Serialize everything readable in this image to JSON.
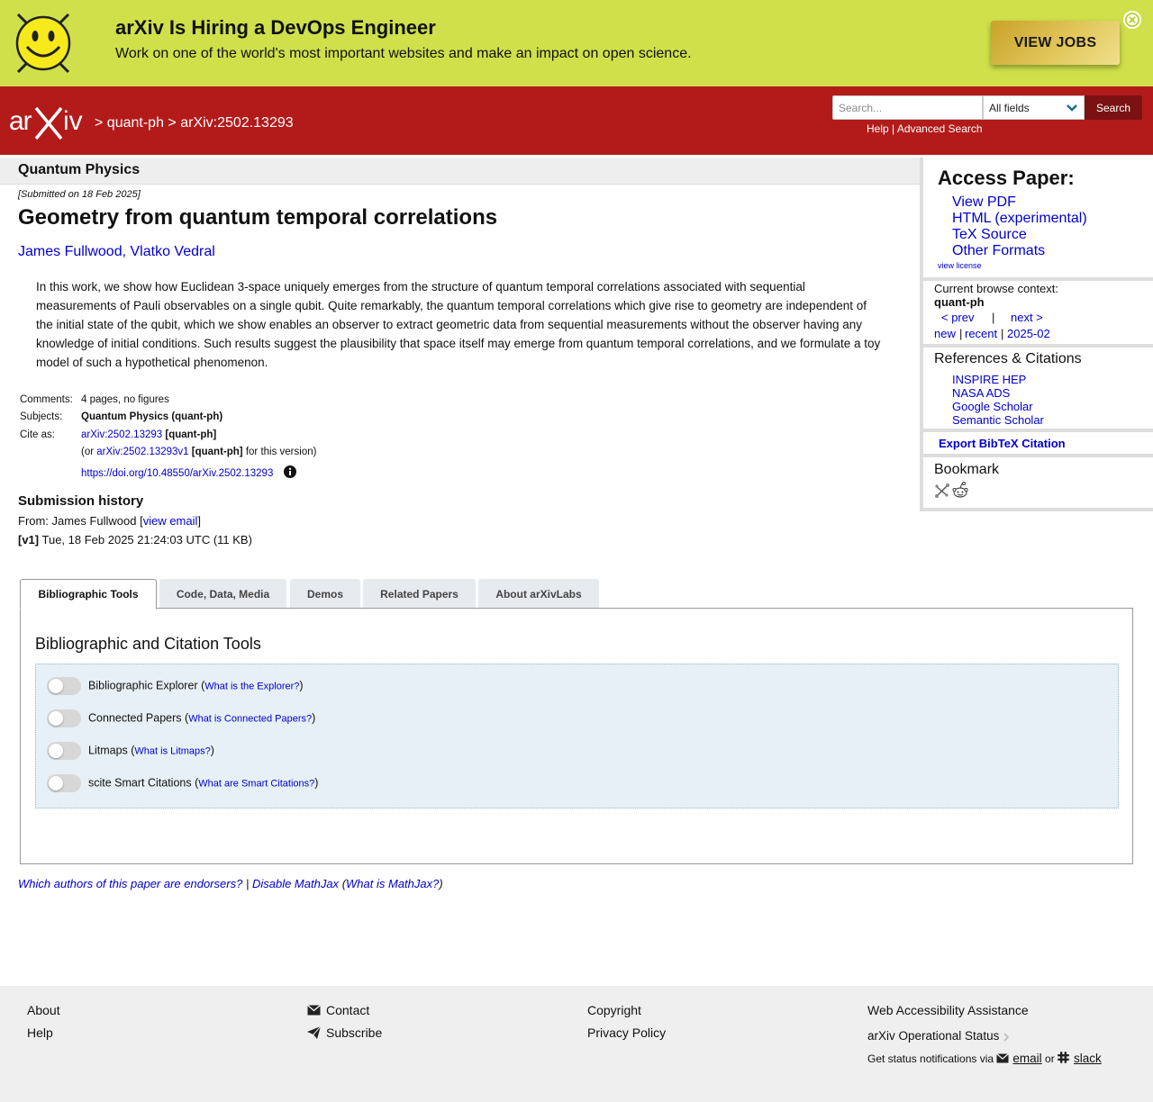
{
  "banner": {
    "title": "arXiv Is Hiring a DevOps Engineer",
    "subtitle": "Work on one of the world's most important websites and make an impact on open science.",
    "cta": "VIEW JOBS",
    "bg_color": "#cfe04a"
  },
  "header": {
    "brand_color": "#b31b1b",
    "crumb_sep": ">",
    "crumb_category": "quant-ph",
    "crumb_id": "arXiv:2502.13293",
    "search_placeholder": "Search...",
    "search_field": "All fields",
    "search_button": "Search",
    "help_link": "Help",
    "links_sep": "|",
    "advanced_link": "Advanced Search"
  },
  "paper": {
    "subject": "Quantum Physics",
    "submitted": "[Submitted on 18 Feb 2025]",
    "title": "Geometry from quantum temporal correlations",
    "authors": [
      "James Fullwood",
      "Vlatko Vedral"
    ],
    "author_sep": ", ",
    "abstract": "In this work, we show how Euclidean 3-space uniquely emerges from the structure of quantum temporal correlations associated with sequential measurements of Pauli observables on a single qubit. Quite remarkably, the quantum temporal correlations which give rise to geometry are independent of the initial state of the qubit, which we show enables an observer to extract geometric data from sequential measurements without the observer having any knowledge of initial conditions. Such results suggest the plausibility that space itself may emerge from quantum temporal correlations, and we formulate a toy model of such a hypothetical phenomenon.",
    "comments_label": "Comments:",
    "comments": "4 pages, no figures",
    "subjects_label": "Subjects:",
    "subjects": "Quantum Physics (quant-ph)",
    "cite_label": "Cite as:",
    "cite_id": "arXiv:2502.13293",
    "cite_cat": "[quant-ph]",
    "version_prefix": "(or",
    "version_id": "arXiv:2502.13293v1",
    "version_cat": "[quant-ph]",
    "version_suffix": "for this version)",
    "doi": "https://doi.org/10.48550/arXiv.2502.13293"
  },
  "history": {
    "title": "Submission history",
    "from_prefix": "From: James Fullwood [",
    "from_link": "view email",
    "from_suffix": "]",
    "v1_label": "[v1]",
    "v1_text": "Tue, 18 Feb 2025 21:24:03 UTC (11 KB)"
  },
  "tabs": [
    {
      "label": "Bibliographic Tools",
      "active": true
    },
    {
      "label": "Code, Data, Media",
      "active": false
    },
    {
      "label": "Demos",
      "active": false
    },
    {
      "label": "Related Papers",
      "active": false
    },
    {
      "label": "About arXivLabs",
      "active": false
    }
  ],
  "tools": {
    "title": "Bibliographic and Citation Tools",
    "rows": [
      {
        "label": "Bibliographic Explorer",
        "help": "What is the Explorer?",
        "enabled": false
      },
      {
        "label": "Connected Papers",
        "help": "What is Connected Papers?",
        "enabled": false
      },
      {
        "label": "Litmaps",
        "help": "What is Litmaps?",
        "enabled": false
      },
      {
        "label": "scite Smart Citations",
        "help": "What are Smart Citations?",
        "enabled": false
      }
    ]
  },
  "bottom_links": {
    "endorsers": "Which authors of this paper are endorsers?",
    "sep": "|",
    "mathjax": "Disable MathJax",
    "mathjax_help": "What is MathJax?",
    "paren_open": "(",
    "paren_close": ")"
  },
  "sidebar": {
    "access_title": "Access Paper:",
    "access_links": [
      "View PDF",
      "HTML (experimental)",
      "TeX Source",
      "Other Formats"
    ],
    "view_license": "view license",
    "context_label": "Current browse context:",
    "context_value": "quant-ph",
    "prev": "< prev",
    "pipe": "|",
    "next": "next >",
    "new": "new",
    "recent": "recent",
    "month": "2025-02",
    "refs_title": "References & Citations",
    "refs_links": [
      "INSPIRE HEP",
      "NASA ADS",
      "Google Scholar",
      "Semantic Scholar"
    ],
    "export": "Export BibTeX Citation",
    "bookmark": "Bookmark"
  },
  "footer": {
    "col1": [
      "About",
      "Help"
    ],
    "contact": "Contact",
    "subscribe": "Subscribe",
    "col3": [
      "Copyright",
      "Privacy Policy"
    ],
    "accessibility": "Web Accessibility Assistance",
    "status": "arXiv Operational Status",
    "notify_prefix": "Get status notifications via",
    "notify_email": "email",
    "notify_or": "or",
    "notify_slack": "slack"
  }
}
